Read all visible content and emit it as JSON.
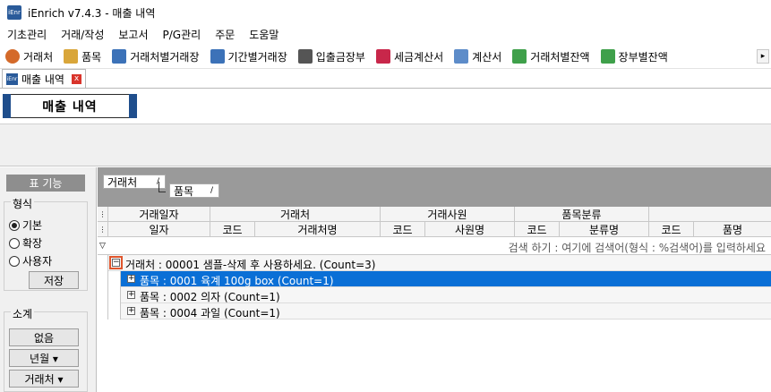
{
  "app": {
    "title": "iEnrich v7.4.3 - 매출 내역",
    "logo_text": "iEnr"
  },
  "menu": [
    "기초관리",
    "거래/작성",
    "보고서",
    "P/G관리",
    "주문",
    "도움말"
  ],
  "toolbar": [
    {
      "label": "거래처",
      "icon": "person-icon",
      "color": "#d46a2a"
    },
    {
      "label": "품목",
      "icon": "box-icon",
      "color": "#d9a63a"
    },
    {
      "label": "거래처별거래장",
      "icon": "ledger-icon",
      "color": "#3c72b8"
    },
    {
      "label": "기간별거래장",
      "icon": "ledger-icon",
      "color": "#3c72b8"
    },
    {
      "label": "입출금장부",
      "icon": "book-icon",
      "color": "#555555"
    },
    {
      "label": "세금계산서",
      "icon": "invoice-icon",
      "color": "#c8274a"
    },
    {
      "label": "계산서",
      "icon": "document-icon",
      "color": "#5d8cc9"
    },
    {
      "label": "거래처별잔액",
      "icon": "money-icon",
      "color": "#3fa04a"
    },
    {
      "label": "장부별잔액",
      "icon": "money-icon",
      "color": "#3fa04a"
    }
  ],
  "doc_tab": {
    "label": "매출 내역",
    "close": "x"
  },
  "form_title": "매출 내역",
  "left_panel": {
    "header": "표 기능",
    "format_label": "형식",
    "format_options": [
      {
        "label": "기본",
        "selected": true
      },
      {
        "label": "확장",
        "selected": false
      },
      {
        "label": "사용자",
        "selected": false
      }
    ],
    "save_button": "저장",
    "subtotal_label": "소계",
    "subtotal_buttons": [
      "없음",
      "년월 ▾",
      "거래처 ▾"
    ]
  },
  "groupby": {
    "chips": [
      {
        "label": "거래처",
        "sort": "/"
      },
      {
        "label": "품목",
        "sort": "/"
      }
    ]
  },
  "grid": {
    "band_headers": [
      "거래일자",
      "거래처",
      "거래사원",
      "품목분류"
    ],
    "column_headers": [
      "일자",
      "코드",
      "거래처명",
      "코드",
      "사원명",
      "코드",
      "분류명",
      "코드",
      "품명"
    ],
    "search_placeholder": "검색 하기 : 여기에 검색어(형식 : %검색어)를 입력하세요",
    "group_row": "거래처 : 00001 샘플-삭제 후 사용하세요. (Count=3)",
    "sub_rows": [
      {
        "text": "품목 : 0001 육계 100g box (Count=1)",
        "selected": true
      },
      {
        "text": "품목 : 0002 의자   (Count=1)",
        "selected": false
      },
      {
        "text": "품목 : 0004 과일   (Count=1)",
        "selected": false
      }
    ]
  },
  "colors": {
    "selection": "#0a6fd6",
    "focus": "#e0562d",
    "title_accent": "#1f4e8c"
  }
}
